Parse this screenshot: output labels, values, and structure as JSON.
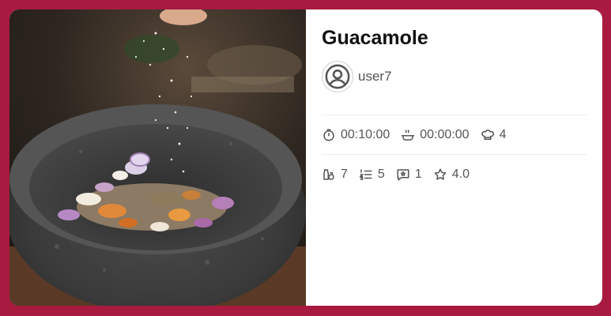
{
  "recipe": {
    "title": "Guacamole",
    "author": "user7",
    "times": {
      "prep_time": "00:10:00",
      "cook_time": "00:00:00",
      "servings": "4"
    },
    "stats": {
      "ingredients": "7",
      "steps": "5",
      "comments": "1",
      "rating": "4.0"
    }
  },
  "icons": {
    "avatar": "user-circle-icon",
    "prep": "timer-icon",
    "cook": "pot-steam-icon",
    "servings": "chef-hat-icon",
    "ingredients": "jars-icon",
    "steps": "numbered-list-icon",
    "comments": "comment-star-icon",
    "rating": "star-icon"
  },
  "colors": {
    "background": "#a81a3f",
    "card": "#ffffff",
    "text_muted": "#555555"
  }
}
